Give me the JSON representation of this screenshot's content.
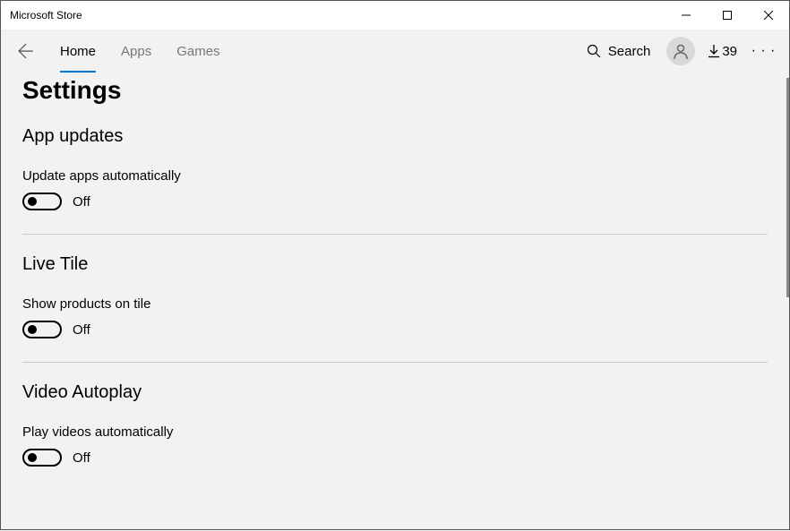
{
  "window": {
    "title": "Microsoft Store"
  },
  "nav": {
    "tabs": [
      {
        "label": "Home",
        "active": true
      },
      {
        "label": "Apps",
        "active": false
      },
      {
        "label": "Games",
        "active": false
      }
    ],
    "search_label": "Search",
    "downloads_count": "39"
  },
  "page": {
    "title": "Settings"
  },
  "sections": [
    {
      "title": "App updates",
      "setting_label": "Update apps automatically",
      "toggle_state": "Off"
    },
    {
      "title": "Live Tile",
      "setting_label": "Show products on tile",
      "toggle_state": "Off"
    },
    {
      "title": "Video Autoplay",
      "setting_label": "Play videos automatically",
      "toggle_state": "Off"
    }
  ]
}
